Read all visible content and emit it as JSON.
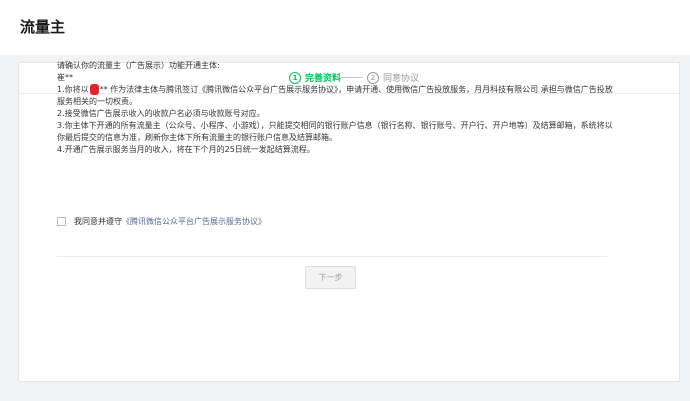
{
  "header": {
    "title": "流量主"
  },
  "steps": [
    {
      "num": "1",
      "label": "完善资料"
    },
    {
      "num": "2",
      "label": "同意协议"
    }
  ],
  "content": {
    "question": "请确认你的流量主（广告展示）功能开通主体:",
    "subject_name": "崔**",
    "item1_prefix": "1.你将以",
    "item1_suffix": "** 作为法律主体与腾讯签订《腾讯微信公众平台广告展示服务协议》，申请开通、使用微信广告投放服务，月月科技有限公司 承担与微信广告投放服务相关的一切权责。",
    "item2": "2.接受微信广告展示收入的收款户名必须与收款账号对应。",
    "item3": "3.你主体下开通的所有流量主（公众号、小程序、小游戏），只能提交相同的银行账户信息（银行名称、银行账号、开户行、开户地等）及结算邮箱，系统将以你最后提交的信息为准，刷新你主体下所有流量主的银行账户信息及结算邮箱。",
    "item4": "4.开通广告展示服务当月的收入，将在下个月的25日统一发起结算流程。"
  },
  "agreement": {
    "prefix": "我同意并遵守",
    "link": "《腾讯微信公众平台广告展示服务协议》",
    "checked": false
  },
  "actions": {
    "next_label": "下一步"
  },
  "colors": {
    "accent": "#07c160",
    "link": "#576b95",
    "inactive": "#9a9a9a",
    "redaction": "#e8222a"
  }
}
